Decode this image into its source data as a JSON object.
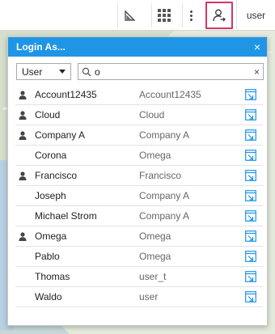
{
  "toolbar": {
    "user_label": "user",
    "icons": [
      "measure-icon",
      "app-grid-icon",
      "more-vertical-icon",
      "login-as-icon"
    ]
  },
  "colors": {
    "header_blue": "#1f95e6",
    "highlight_pink": "#d6336c",
    "link_blue": "#1f95e6"
  },
  "dialog": {
    "title": "Login As...",
    "close_glyph": "×",
    "type_select": {
      "value": "User"
    },
    "search": {
      "value": "o",
      "clear_glyph": "×"
    },
    "rows": [
      {
        "name": "Account12435",
        "account": "Account12435",
        "has_person_icon": true
      },
      {
        "name": "Cloud",
        "account": "Cloud",
        "has_person_icon": true
      },
      {
        "name": "Company A",
        "account": "Company A",
        "has_person_icon": true
      },
      {
        "name": "Corona",
        "account": "Omega",
        "has_person_icon": false
      },
      {
        "name": "Francisco",
        "account": "Francisco",
        "has_person_icon": true
      },
      {
        "name": "Joseph",
        "account": "Company A",
        "has_person_icon": false
      },
      {
        "name": "Michael Strom",
        "account": "Company A",
        "has_person_icon": false
      },
      {
        "name": "Omega",
        "account": "Omega",
        "has_person_icon": true
      },
      {
        "name": "Pablo",
        "account": "Omega",
        "has_person_icon": false
      },
      {
        "name": "Thomas",
        "account": "user_t",
        "has_person_icon": false
      },
      {
        "name": "Waldo",
        "account": "user",
        "has_person_icon": false
      }
    ]
  }
}
